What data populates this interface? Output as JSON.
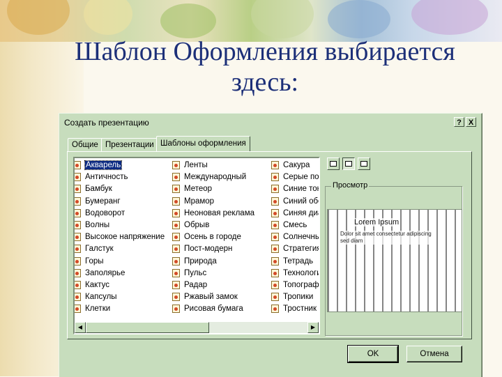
{
  "slide": {
    "title_line1": "Шаблон Оформления выбирается",
    "title_line2": "здесь:"
  },
  "dialog": {
    "title": "Создать презентацию",
    "help_button": "?",
    "close_button": "X",
    "tabs": [
      {
        "label": "Общие",
        "active": false
      },
      {
        "label": "Презентации",
        "active": false
      },
      {
        "label": "Шаблоны оформления",
        "active": true
      }
    ],
    "columns": [
      [
        "Акварель",
        "Античность",
        "Бамбук",
        "Бумеранг",
        "Водоворот",
        "Волны",
        "Высокое напряжение",
        "Галстук",
        "Горы",
        "Заполярье",
        "Кактус",
        "Капсулы",
        "Клетки"
      ],
      [
        "Ленты",
        "Международный",
        "Метеор",
        "Мрамор",
        "Неоновая реклама",
        "Обрыв",
        "Осень в городе",
        "Пост-модерн",
        "Природа",
        "Пульс",
        "Радар",
        "Ржавый замок",
        "Рисовая бумага"
      ],
      [
        "Сакура",
        "Серые пол",
        "Синие тон",
        "Синий обе",
        "Синяя диа",
        "Смесь",
        "Солнечны",
        "Стратегия",
        "Тетрадь",
        "Технологи",
        "Топографі",
        "Тропики",
        "Тростник"
      ]
    ],
    "selected_item": "Акварель",
    "view_buttons": [
      "large-icons",
      "list",
      "details"
    ],
    "preview_label": "Просмотр",
    "preview_title": "Lorem Ipsum",
    "preview_text": [
      "Dolor sit amet consectetur adipiscing",
      "sed diam"
    ],
    "ok_button": "OK",
    "cancel_button": "Отмена"
  }
}
